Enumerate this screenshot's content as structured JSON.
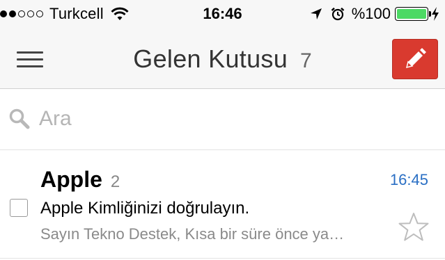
{
  "status_bar": {
    "signal_bars_filled": 2,
    "signal_bars_total": 5,
    "carrier": "Turkcell",
    "time": "16:46",
    "battery_percent": "%100",
    "battery_level": 1.0,
    "battery_color": "#4cd964",
    "icons": [
      "wifi-icon",
      "location-arrow-icon",
      "alarm-icon",
      "charging-bolt-icon"
    ]
  },
  "header": {
    "title": "Gelen Kutusu",
    "unread_count": "7",
    "menu_icon": "hamburger-menu-icon",
    "compose_icon": "pencil-icon",
    "compose_color": "#d93a2f"
  },
  "search": {
    "placeholder": "Ara",
    "value": "",
    "icon": "search-icon"
  },
  "mail_list": [
    {
      "sender": "Apple",
      "thread_count": "2",
      "time": "16:45",
      "subject": "Apple Kimliğinizi doğrulayın.",
      "snippet": "Sayın Tekno Destek, Kısa bir süre önce ya…",
      "checked": false,
      "starred": false
    }
  ],
  "colors": {
    "time_accent": "#2a6fc4",
    "header_bg": "#f7f7f7"
  }
}
